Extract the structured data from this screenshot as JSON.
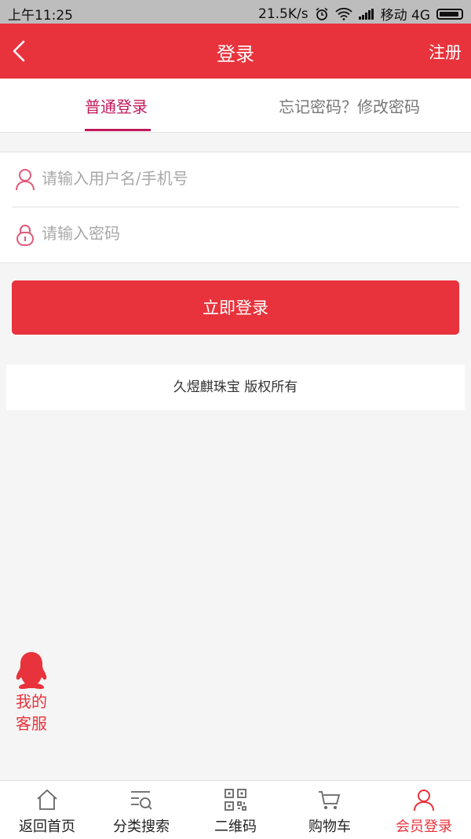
{
  "status_bar": {
    "time": "上午11:25",
    "speed": "21.5K/s",
    "carrier": "移动 4G"
  },
  "header": {
    "title": "登录",
    "register_label": "注册"
  },
  "tabs": {
    "normal_login": "普通登录",
    "forgot_password": "忘记密码？修改密码"
  },
  "form": {
    "username_placeholder": "请输入用户名/手机号",
    "username_value": "",
    "password_placeholder": "请输入密码",
    "password_value": ""
  },
  "submit_label": "立即登录",
  "copyright": "久煜麒珠宝 版权所有",
  "customer_service": {
    "line1": "我的",
    "line2": "客服"
  },
  "bottom_nav": [
    {
      "label": "返回首页",
      "icon": "home-icon"
    },
    {
      "label": "分类搜索",
      "icon": "category-search-icon"
    },
    {
      "label": "二维码",
      "icon": "qrcode-icon"
    },
    {
      "label": "购物车",
      "icon": "cart-icon"
    },
    {
      "label": "会员登录",
      "icon": "member-icon",
      "active": true
    }
  ],
  "colors": {
    "brand_red": "#e8333c",
    "tab_active": "#c2185b"
  }
}
